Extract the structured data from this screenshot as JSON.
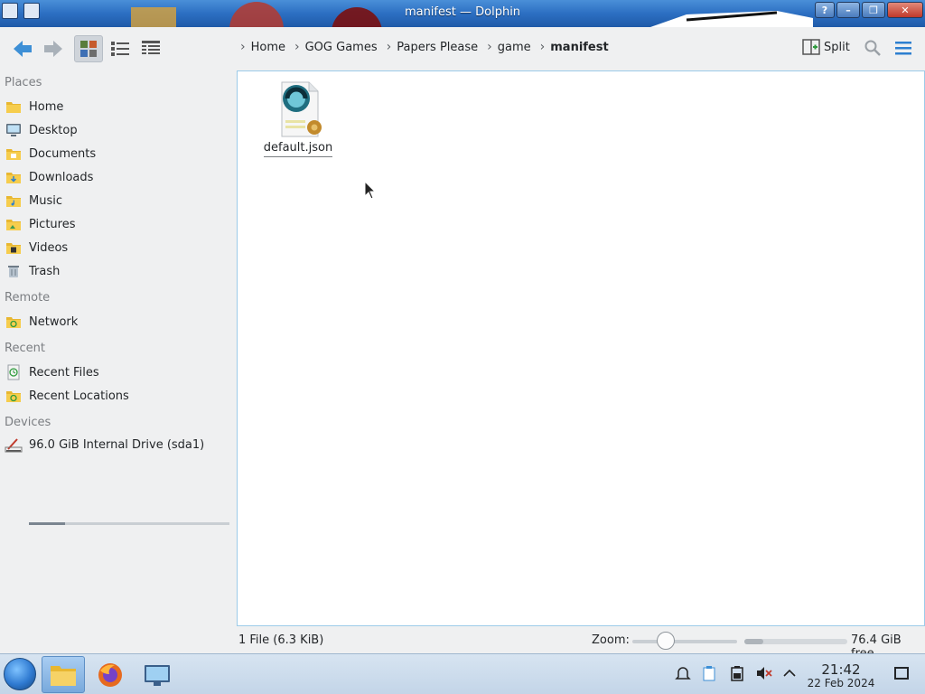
{
  "window": {
    "title": "manifest — Dolphin"
  },
  "toolbar": {
    "breadcrumb": [
      "Home",
      "GOG Games",
      "Papers Please",
      "game",
      "manifest"
    ],
    "split_label": "Split"
  },
  "sidebar": {
    "sections": [
      {
        "title": "Places",
        "items": [
          {
            "label": "Home",
            "icon": "home-folder-icon"
          },
          {
            "label": "Desktop",
            "icon": "desktop-icon"
          },
          {
            "label": "Documents",
            "icon": "documents-folder-icon"
          },
          {
            "label": "Downloads",
            "icon": "downloads-folder-icon"
          },
          {
            "label": "Music",
            "icon": "music-folder-icon"
          },
          {
            "label": "Pictures",
            "icon": "pictures-folder-icon"
          },
          {
            "label": "Videos",
            "icon": "videos-folder-icon"
          },
          {
            "label": "Trash",
            "icon": "trash-icon"
          }
        ]
      },
      {
        "title": "Remote",
        "items": [
          {
            "label": "Network",
            "icon": "network-folder-icon"
          }
        ]
      },
      {
        "title": "Recent",
        "items": [
          {
            "label": "Recent Files",
            "icon": "recent-files-icon"
          },
          {
            "label": "Recent Locations",
            "icon": "recent-locations-icon"
          }
        ]
      },
      {
        "title": "Devices",
        "items": [
          {
            "label": "96.0 GiB Internal Drive (sda1)",
            "icon": "drive-icon",
            "usage_fraction": 0.18
          }
        ]
      }
    ]
  },
  "files": [
    {
      "name": "default.json",
      "icon": "json-file-icon"
    }
  ],
  "statusbar": {
    "summary": "1 File (6.3 KiB)",
    "zoom_label": "Zoom:",
    "zoom_fraction": 0.28,
    "free_space": "76.4 GiB free",
    "used_fraction": 0.18
  },
  "taskbar": {
    "apps": [
      "file-manager-icon",
      "firefox-icon",
      "system-settings-icon"
    ],
    "time": "21:42",
    "date": "22 Feb 2024"
  },
  "colors": {
    "accent": "#3daee9",
    "view_border": "#9ccbe9",
    "taskbar": "#c3d5e8"
  }
}
